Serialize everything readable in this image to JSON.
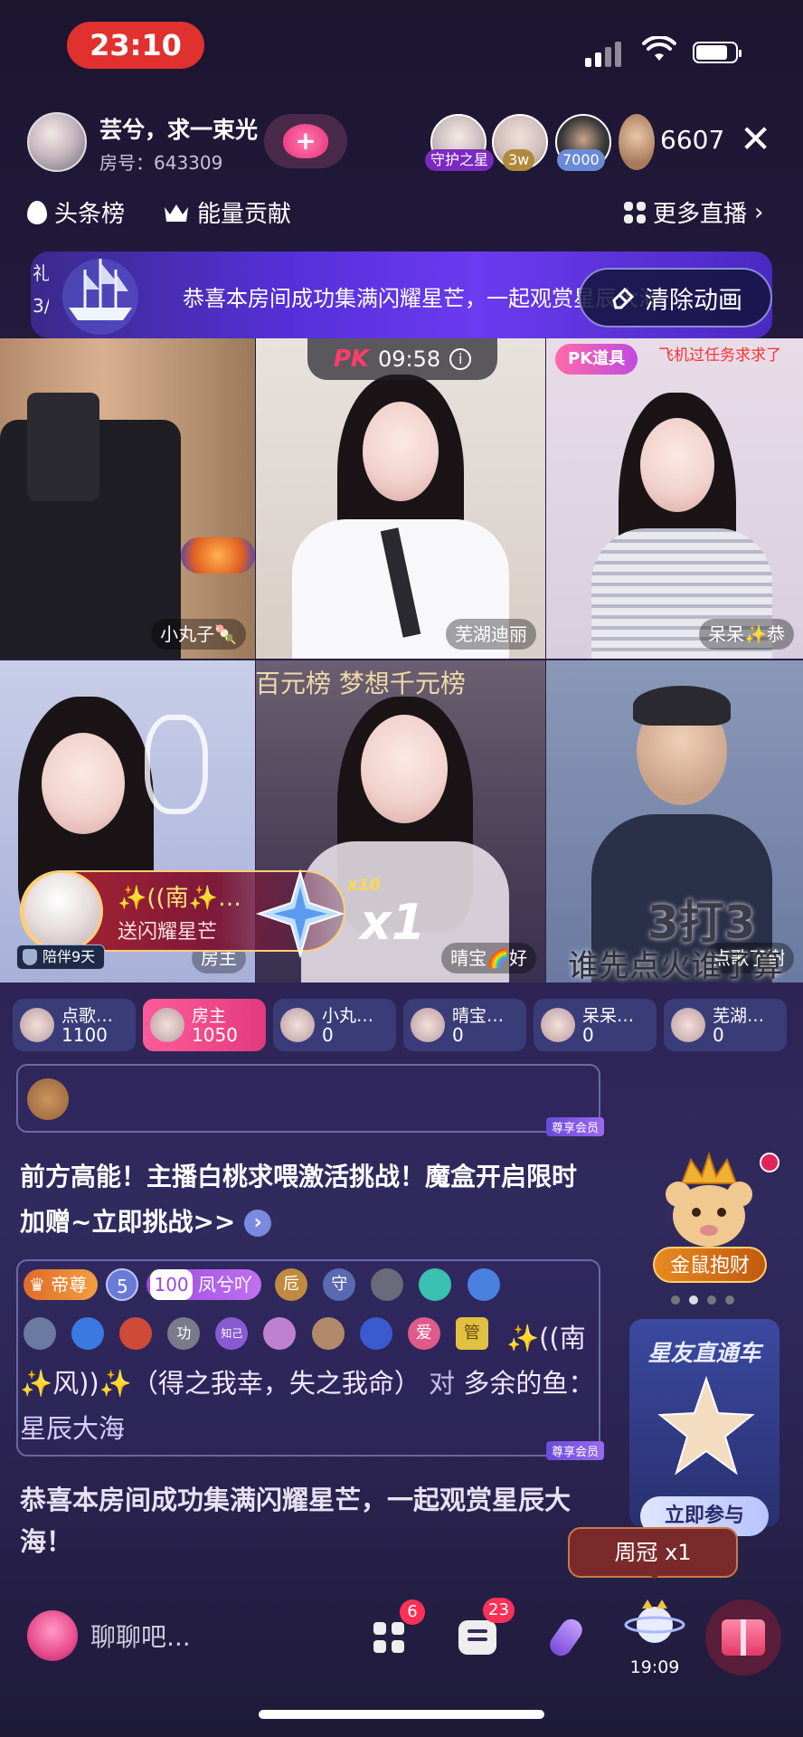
{
  "status_bar": {
    "time": "23:10"
  },
  "header": {
    "host_name": "芸兮，求一束光",
    "room_no": "房号：643309",
    "viewer_badges": [
      "守护之星",
      "3w",
      "7000"
    ],
    "viewer_count": "6607"
  },
  "rank_row": {
    "headline_rank": "头条榜",
    "energy_contrib": "能量贡献",
    "more_live": "更多直播"
  },
  "banner": {
    "left_text": "礼\n3/",
    "message": "恭喜本房间成功集满闪耀星芒，一起观赏星辰大海！",
    "clear_button": "清除动画"
  },
  "pk": {
    "logo": "PK",
    "timer": "09:58",
    "tool": "PK道具",
    "tool_note": "飞机过任务求求了"
  },
  "streams": [
    {
      "name": "小丸子🍡"
    },
    {
      "name": "芜湖迪丽"
    },
    {
      "name": "呆呆✨恭"
    },
    {
      "name": ""
    },
    {
      "name": "晴宝🌈好"
    },
    {
      "name": "点歌了谢"
    }
  ],
  "overlay": {
    "thousand_rank": "百元榜  梦想千元榜",
    "host_tag": "房主",
    "three_vs": "3打3",
    "fire_first": "谁先点火谁了算"
  },
  "gift_popup": {
    "sender": "✨((南✨…",
    "desc": "送闪耀星芒",
    "multiplier_small": "x10",
    "multiplier": "x1",
    "companion": "陪伴9天"
  },
  "scores": [
    {
      "name": "点歌…",
      "value": "1100"
    },
    {
      "name": "房主",
      "value": "1050"
    },
    {
      "name": "小丸…",
      "value": "0"
    },
    {
      "name": "晴宝…",
      "value": "0"
    },
    {
      "name": "呆呆…",
      "value": "0"
    },
    {
      "name": "芜湖…",
      "value": "0"
    }
  ],
  "chat": {
    "member_tag": "尊享会员",
    "notice": "前方高能！主播白桃求喂激活挑战！魔盒开启限时加赠~立即挑战>>",
    "badge_rank": "帝尊",
    "badge_level": "5",
    "badge_fan": "100",
    "badge_fan_name": "凤兮吖",
    "badge_chars": [
      "卮",
      "守",
      "功",
      "知己",
      "爱",
      "管"
    ],
    "line_user": "✨((南✨风))✨（得之我幸，失之我命）",
    "line_to": "对",
    "line_target": "多余的鱼",
    "line_colon": "：",
    "line_content": "星辰大海",
    "system": "恭喜本房间成功集满闪耀星芒，一起观赏星辰大海！"
  },
  "side": {
    "rat_label": "金鼠抱财",
    "star_title": "星友直通车",
    "join": "立即参与",
    "weekly": "周冠 x1"
  },
  "bottom_bar": {
    "chat_placeholder": "聊聊吧...",
    "apps_count": "6",
    "msg_count": "23",
    "planet_time": "19:09"
  }
}
